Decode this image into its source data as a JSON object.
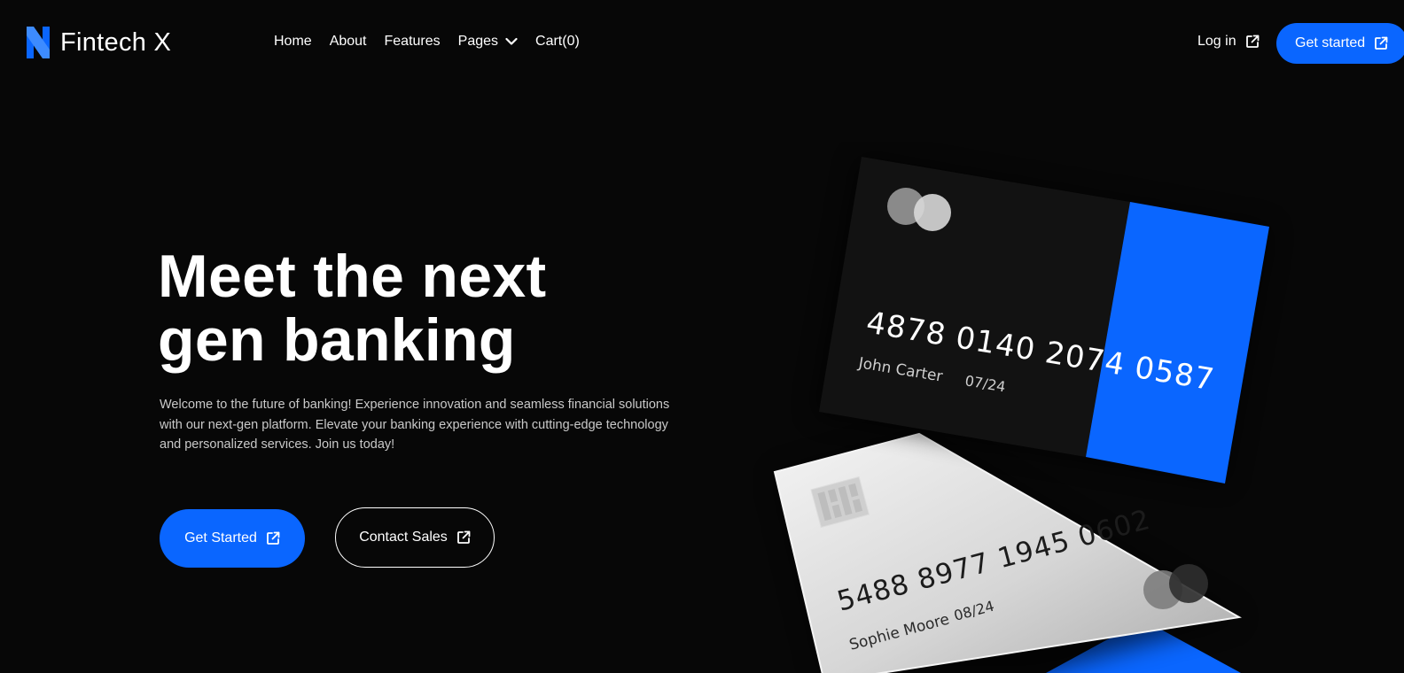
{
  "brand": {
    "name": "Fintech X",
    "accent": "#0a66ff",
    "background": "#070707"
  },
  "nav": {
    "items": [
      {
        "label": "Home"
      },
      {
        "label": "About"
      },
      {
        "label": "Features"
      },
      {
        "label": "Pages",
        "icon": "chevron-down-icon"
      },
      {
        "label": "Cart(0)"
      }
    ],
    "login_label": "Log in",
    "cta_label": "Get started"
  },
  "hero": {
    "title_line1": "Meet the next",
    "title_line2": "gen banking",
    "description": "Welcome to the future of banking! Experience innovation and seamless financial solutions with our next-gen platform. Elevate your banking experience with cutting-edge technology and personalized services. Join us today!",
    "primary_button": "Get Started",
    "secondary_button": "Contact Sales"
  },
  "cards": {
    "dark_card": {
      "number": "4878 0140 2074 0587",
      "holder": "John Carter",
      "expiry": "07/24"
    },
    "light_card": {
      "number": "5488 8977 1945 0602",
      "holder": "Sophie Moore",
      "expiry": "08/24"
    }
  }
}
